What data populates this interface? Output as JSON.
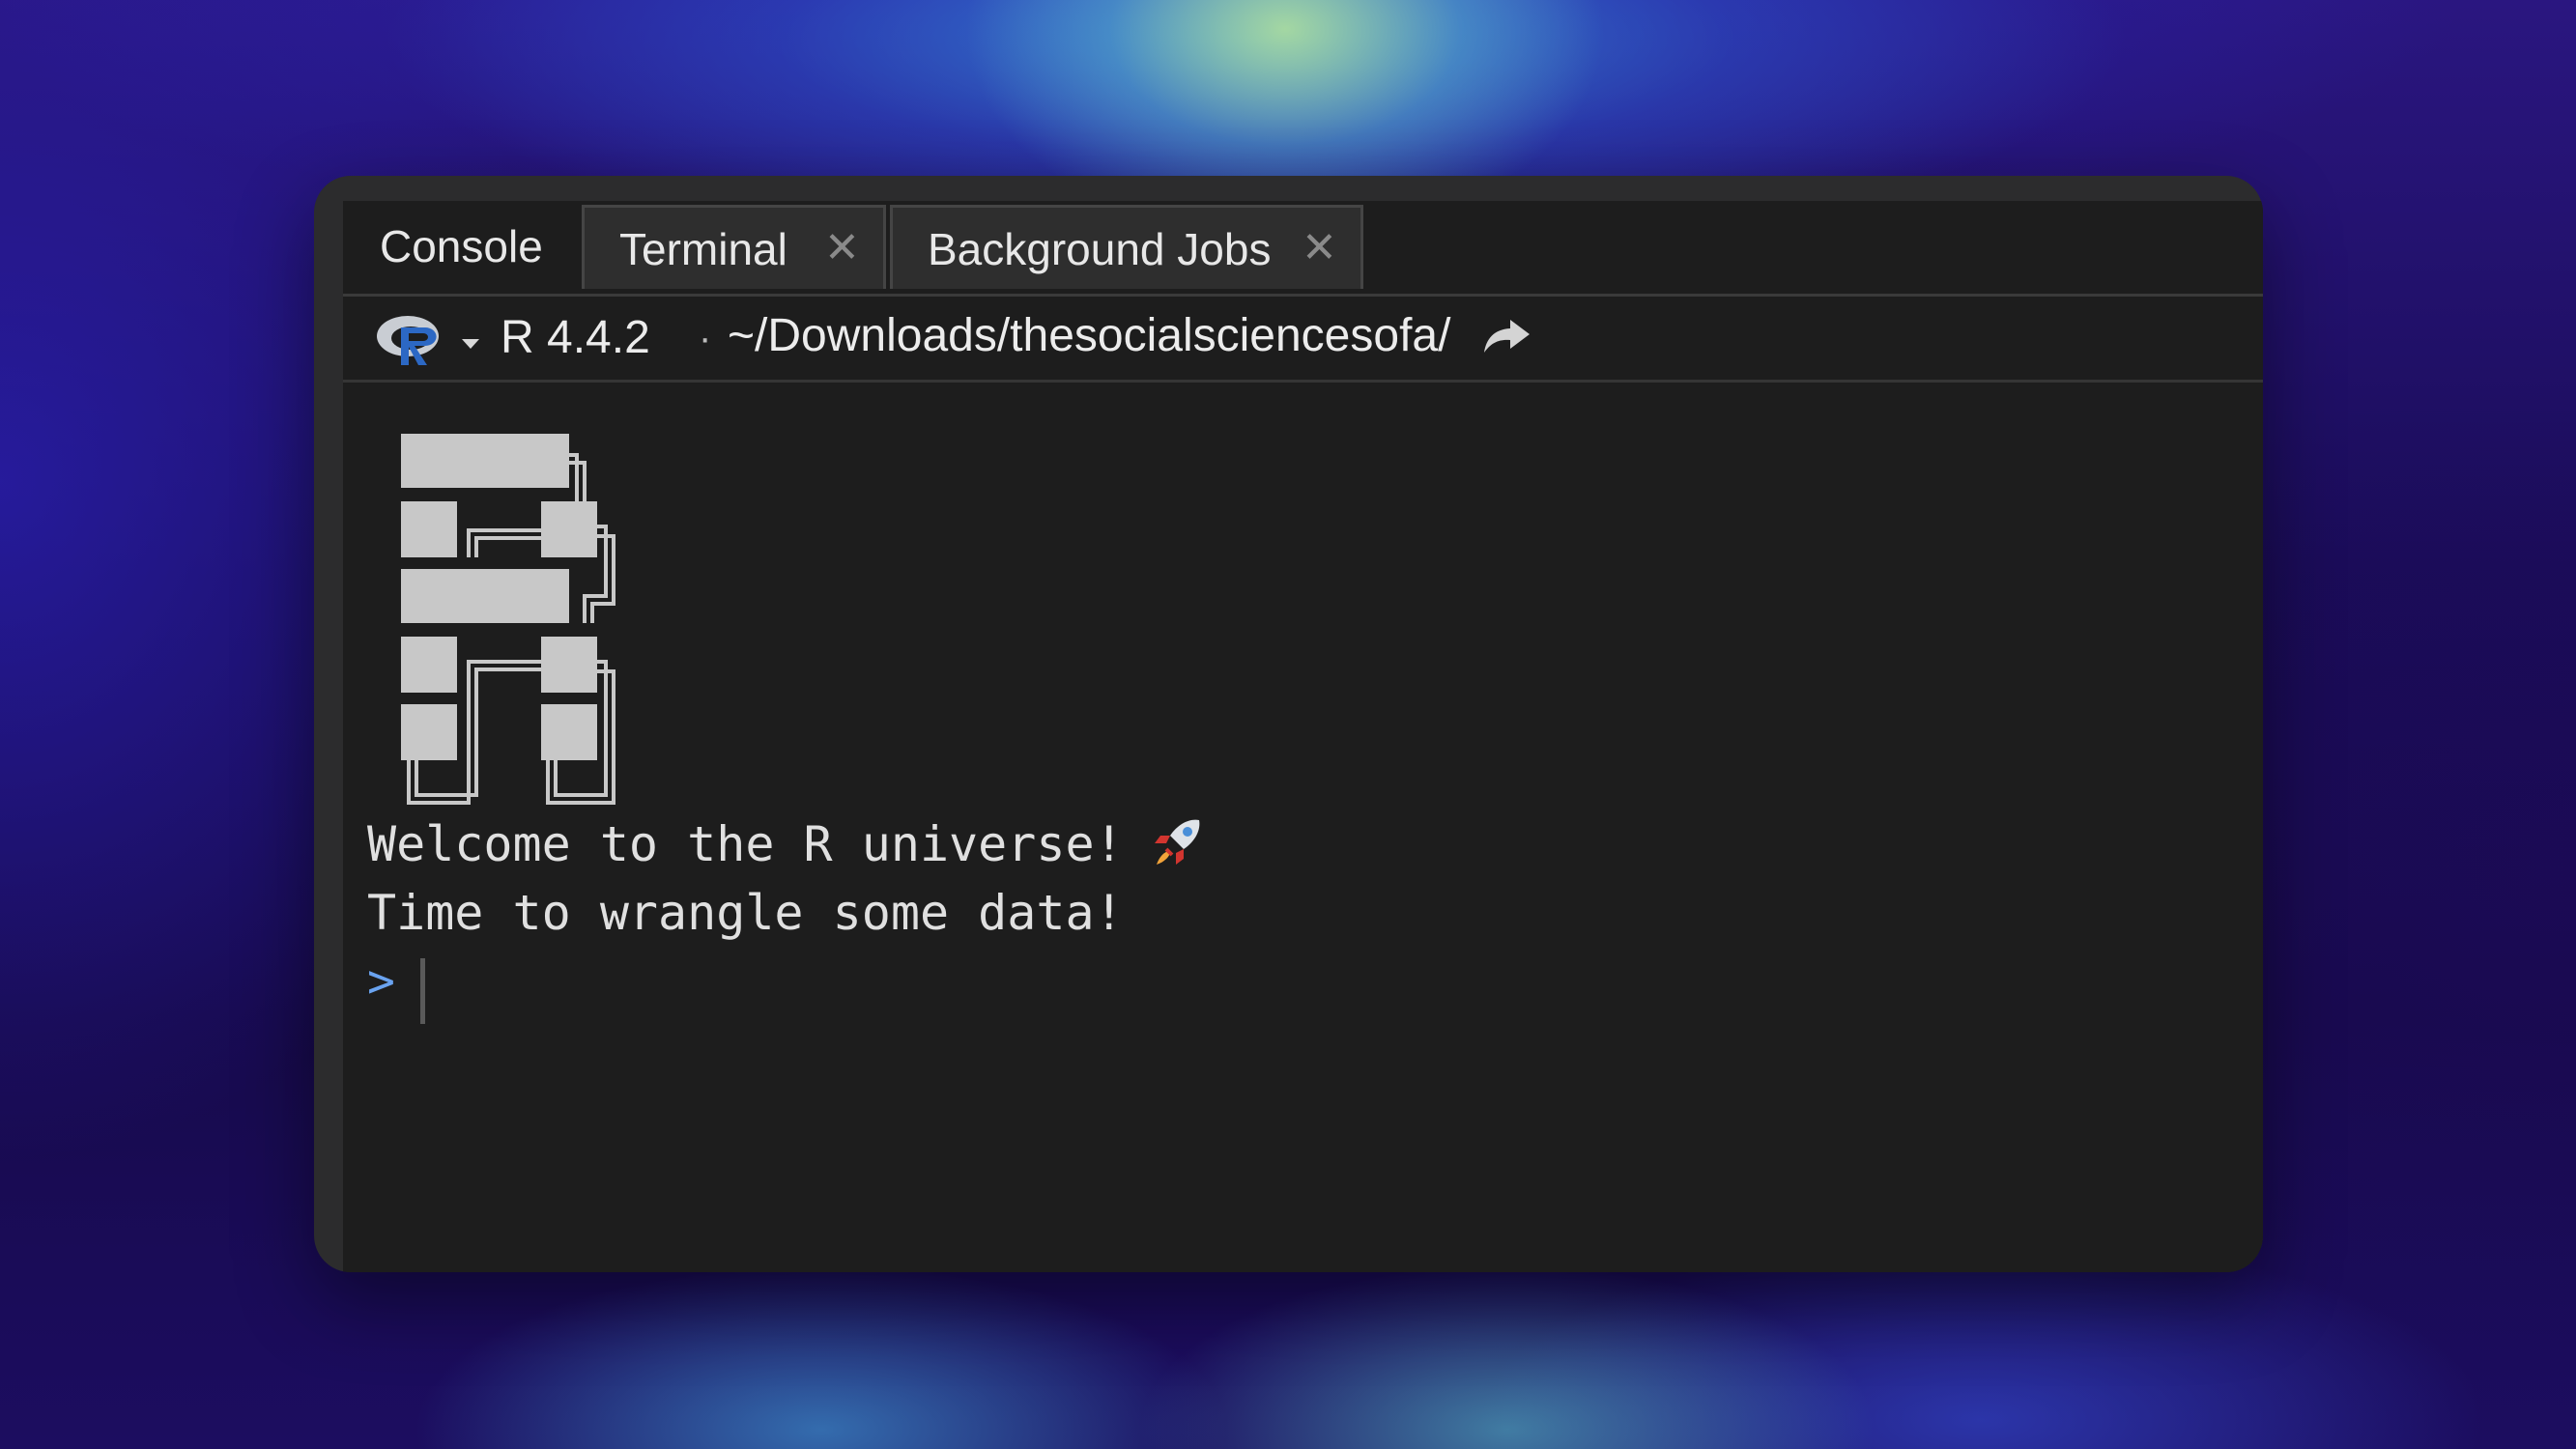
{
  "tabs": [
    {
      "label": "Console",
      "active": true,
      "closable": false
    },
    {
      "label": "Terminal",
      "active": false,
      "closable": true,
      "close_glyph": "✕"
    },
    {
      "label": "Background Jobs",
      "active": false,
      "closable": true,
      "close_glyph": "✕"
    }
  ],
  "toolbar": {
    "r_version": "R 4.4.2",
    "separator": "·",
    "working_directory": "~/Downloads/thesocialsciencesofa/",
    "r_logo_icon": "r-logo-icon",
    "dropdown_icon": "chevron-down-icon",
    "goto_icon": "go-to-directory-icon"
  },
  "console": {
    "logo_icon": "ascii-r-logo",
    "lines": [
      "Welcome to the R universe!",
      "Time to wrangle some data!"
    ],
    "rocket_icon": "rocket-icon",
    "prompt": ">"
  },
  "colors": {
    "pane_background": "#1d1d1d",
    "window_frame": "#2c2c2d",
    "text": "#e0e0e0",
    "prompt": "#6aa3f0",
    "r_logo_blue": "#2c68c4"
  }
}
